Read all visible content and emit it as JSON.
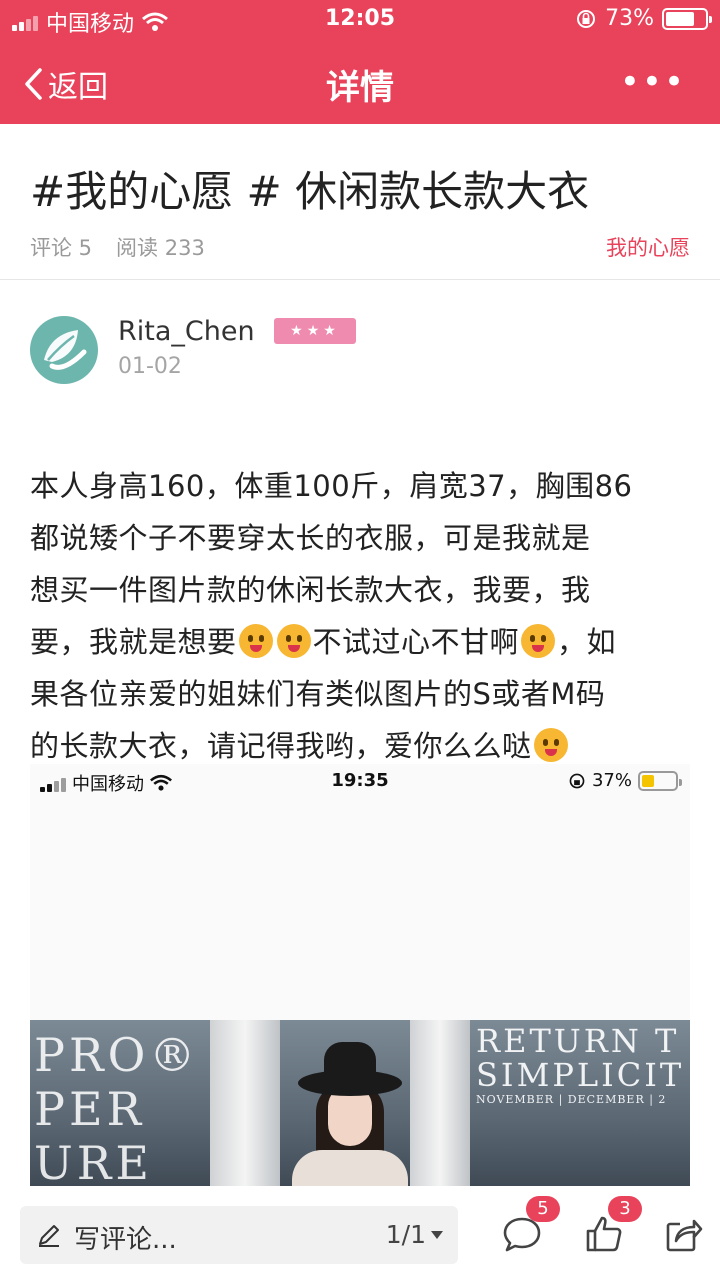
{
  "status_bar": {
    "carrier": "中国移动",
    "time": "12:05",
    "battery": "73%",
    "battery_level": 0.73
  },
  "nav": {
    "back_label": "返回",
    "title": "详情",
    "more_label": "•••"
  },
  "post": {
    "title": "#我的心愿 # 休闲款长款大衣",
    "comments_label": "评论 5",
    "reads_label": "阅读 233",
    "topic_tag": "我的心愿",
    "body": {
      "line1": "本人身高160，体重100斤，肩宽37，胸围86",
      "line2": "都说矮个子不要穿太长的衣服，可是我就是",
      "line3": "想买一件图片款的休闲长款大衣，我要，我",
      "line4a": "要，我就是想要",
      "line4b": "不试过心不甘啊",
      "line4c": "，如",
      "line5": "果各位亲爱的姐妹们有类似图片的S或者M码",
      "line6": "的长款大衣，请记得我哟，爱你么么哒"
    }
  },
  "author": {
    "name": "Rita_Chen",
    "badge": "★★★",
    "date": "01-02"
  },
  "embedded_screenshot": {
    "carrier": "中国移动",
    "time": "19:35",
    "battery": "37%",
    "battery_level": 0.37,
    "sign_left": "PRO®\nPER\nURE",
    "sign_right_big": "RETURN T\nSIMPLICIT",
    "sign_right_small": "NOVEMBER | DECEMBER | 2"
  },
  "bottom_bar": {
    "comment_placeholder": "写评论...",
    "pager": "1/1",
    "comment_count": "5",
    "like_count": "3"
  },
  "colors": {
    "accent": "#e8435a",
    "badge_pink": "#f08bb0",
    "avatar_teal": "#6cb6ad"
  },
  "icons": [
    "back-chevron-icon",
    "more-dots-icon",
    "wifi-icon",
    "signal-icon",
    "lock-rotation-icon",
    "battery-icon",
    "pen-icon",
    "caret-down-icon",
    "comment-bubble-icon",
    "thumb-up-icon",
    "share-icon"
  ]
}
